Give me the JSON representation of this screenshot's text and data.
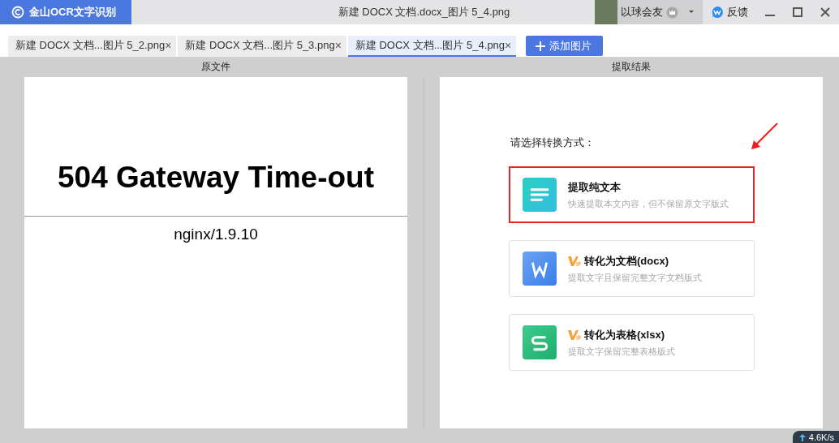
{
  "app": {
    "name": "金山OCR文字识别"
  },
  "window": {
    "title": "新建 DOCX 文档.docx_图片 5_4.png"
  },
  "user": {
    "name": "以球会友"
  },
  "feedback": {
    "label": "反馈"
  },
  "tabs": [
    {
      "label": "新建 DOCX 文档...图片 5_2.png",
      "close": "×",
      "selected": false
    },
    {
      "label": "新建 DOCX 文档...图片 5_3.png",
      "close": "×",
      "selected": false
    },
    {
      "label": "新建 DOCX 文档...图片 5_4.png",
      "close": "×",
      "selected": true
    }
  ],
  "add_button": {
    "label": "添加图片"
  },
  "source": {
    "header": "原文件",
    "heading": "504 Gateway Time-out",
    "footer": "nginx/1.9.10"
  },
  "result": {
    "header": "提取结果",
    "prompt": "请选择转换方式：",
    "options": [
      {
        "kind": "text",
        "title": "提取纯文本",
        "description": "快速提取本文内容，但不保留原文字版式",
        "vip": false,
        "highlighted": true
      },
      {
        "kind": "word",
        "title": "转化为文档(docx)",
        "description": "提取文字且保留完整文字文档版式",
        "vip": true,
        "highlighted": false
      },
      {
        "kind": "sheet",
        "title": "转化为表格(xlsx)",
        "description": "提取文字保留完整表格版式",
        "vip": true,
        "highlighted": false
      }
    ]
  },
  "net_speed": {
    "value": "4.6K/s"
  }
}
